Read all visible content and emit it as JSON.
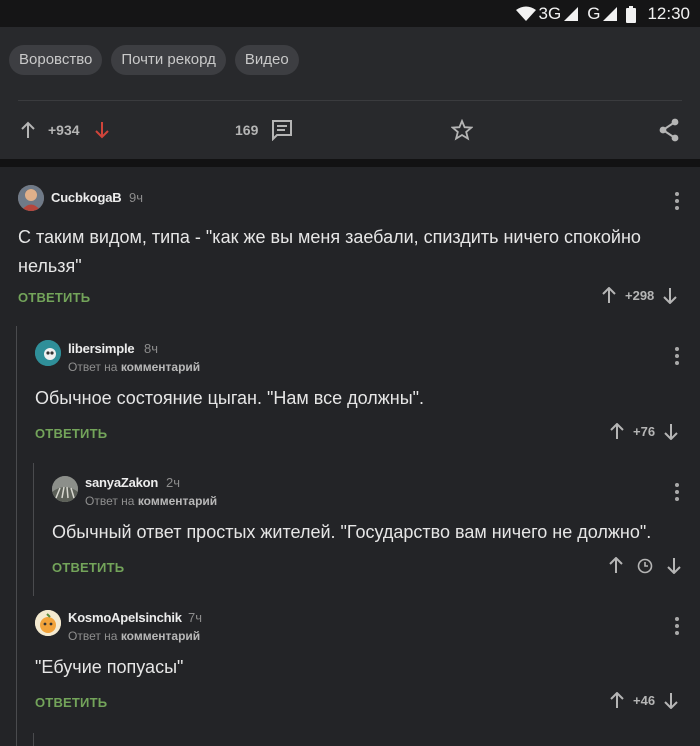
{
  "status_bar": {
    "network": "3G",
    "network2": "G",
    "time": "12:30"
  },
  "post": {
    "tags": [
      "Воровство",
      "Почти рекорд",
      "Видео"
    ],
    "rating": "+934",
    "comments_count": "169"
  },
  "comments": [
    {
      "user": "CucbkogaB",
      "time": "9ч",
      "reply_note": "",
      "text": "С таким видом, типа - \"как же вы меня заебали, спиздить ничего спокойно нельзя\"",
      "reply_label": "ОТВЕТИТЬ",
      "rating": "+298"
    },
    {
      "user": "libersimple",
      "time": "8ч",
      "reply_note_prefix": "Ответ на",
      "reply_note_target": "комментарий",
      "text": "Обычное состояние цыган. \"Нам все должны\".",
      "reply_label": "ОТВЕТИТЬ",
      "rating": "+76"
    },
    {
      "user": "sanyaZakon",
      "time": "2ч",
      "reply_note_prefix": "Ответ на",
      "reply_note_target": "комментарий",
      "text": "Обычный ответ простых жителей. \"Государство вам ничего не должно\".",
      "reply_label": "ОТВЕТИТЬ",
      "rating": ""
    },
    {
      "user": "KosmoApelsinchik",
      "time": "7ч",
      "reply_note_prefix": "Ответ на",
      "reply_note_target": "комментарий",
      "text": "\"Ебучие попуасы\"",
      "reply_label": "ОТВЕТИТЬ",
      "rating": "+46"
    }
  ],
  "colors": {
    "background": "#232427",
    "reply_green": "#73a45a",
    "downvote_red": "#d0443a"
  }
}
